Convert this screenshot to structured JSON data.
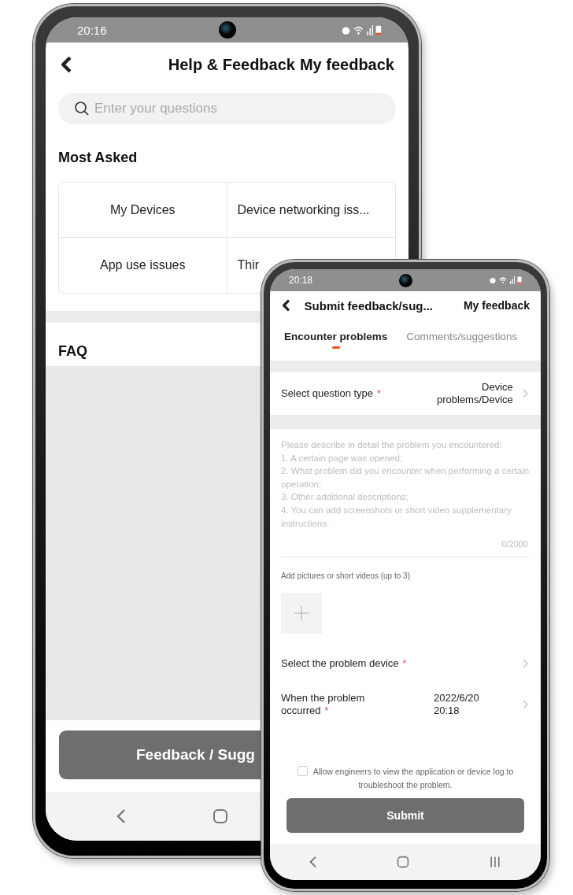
{
  "back_phone": {
    "status_bar": {
      "time": "20:16"
    },
    "header": {
      "title": "Help & Feedback",
      "action": "My feedback"
    },
    "search": {
      "placeholder": "Enter your questions"
    },
    "most_asked": {
      "title": "Most Asked",
      "items": [
        "My Devices",
        "Device networking iss...",
        "App use issues",
        "Thir"
      ]
    },
    "faq": {
      "title": "FAQ"
    },
    "button": "Feedback / Sugg"
  },
  "front_phone": {
    "status_bar": {
      "time": "20:18"
    },
    "header": {
      "title": "Submit feedback/sug...",
      "action": "My feedback"
    },
    "tabs": [
      {
        "label": "Encounter problems",
        "selected": true
      },
      {
        "label": "Comments/suggestions",
        "selected": false
      }
    ],
    "question_type": {
      "label": "Select question type",
      "required_mark": "*",
      "value": "Device problems/Device"
    },
    "description": {
      "placeholder": "Please describe in detail the problem you encountered:\n1. A certain page was opened;\n2. What problem did you encounter when performing a certain operation;\n3. Other additional descriptions;\n4. You can add screenshots or short video supplementary instructions.",
      "counter": "0/2000"
    },
    "attachments": {
      "label": "Add pictures or short videos (up to 3)"
    },
    "rows": [
      {
        "label": "Select the problem device",
        "required_mark": "*"
      },
      {
        "label": "When the problem occurred",
        "required_mark": "*",
        "value": "2022/6/20 20:18"
      }
    ],
    "log_consent": {
      "label": "Allow engineers to view the application or device log to troubleshoot the problem.",
      "checked": false
    },
    "submit": "Submit"
  }
}
